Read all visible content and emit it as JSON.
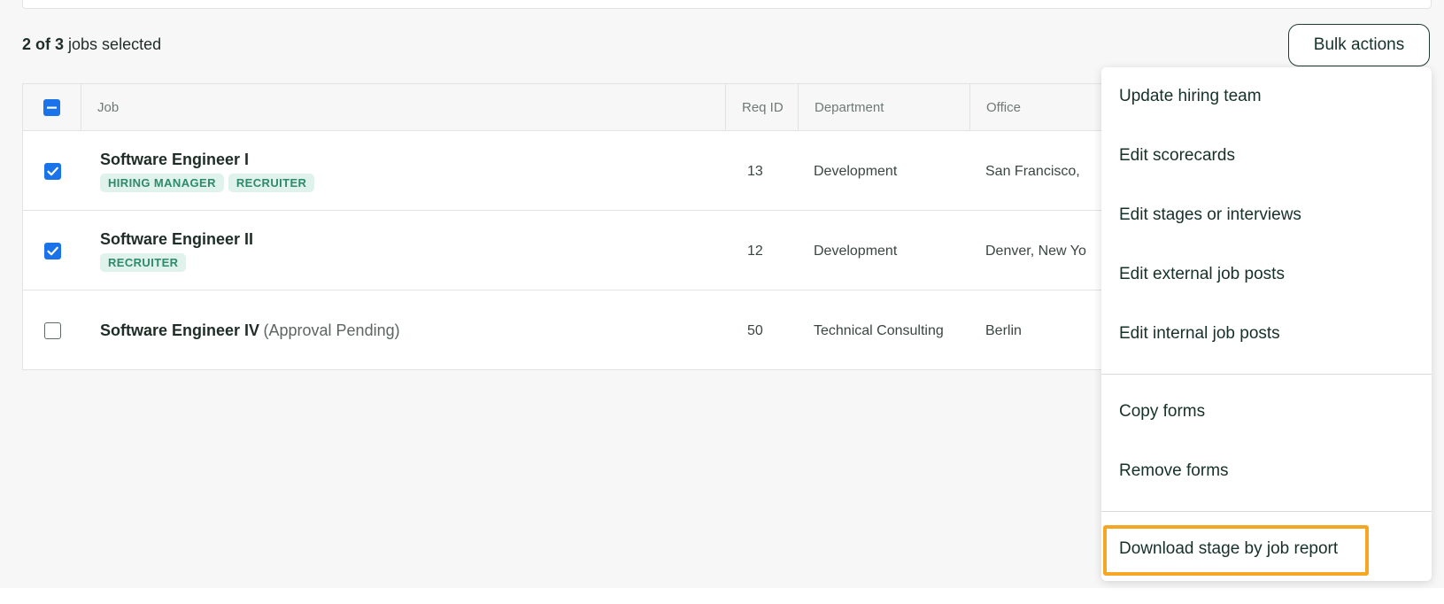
{
  "summary": {
    "selected": "2 of 3",
    "suffix": "jobs selected"
  },
  "bulk_actions": {
    "label": "Bulk actions"
  },
  "table": {
    "columns": [
      "Job",
      "Req ID",
      "Department",
      "Office"
    ],
    "rows": [
      {
        "checked": true,
        "title": "Software Engineer I",
        "note": "",
        "tags": [
          "HIRING MANAGER",
          "RECRUITER"
        ],
        "req_id": "13",
        "department": "Development",
        "office": "San Francisco,"
      },
      {
        "checked": true,
        "title": "Software Engineer II",
        "note": "",
        "tags": [
          "RECRUITER"
        ],
        "req_id": "12",
        "department": "Development",
        "office": "Denver, New Yo"
      },
      {
        "checked": false,
        "title": "Software Engineer IV",
        "note": "(Approval Pending)",
        "tags": [],
        "req_id": "50",
        "department": "Technical Consulting",
        "office": "Berlin"
      }
    ]
  },
  "menu": {
    "items": [
      "Update hiring team",
      "Edit scorecards",
      "Edit stages or interviews",
      "Edit external job posts",
      "Edit internal job posts",
      "Copy forms",
      "Remove forms",
      "Download stage by job report"
    ]
  },
  "colors": {
    "checkbox_blue": "#1a73e8",
    "tag_bg": "#dff2eb",
    "tag_text": "#2e8a6a",
    "highlight": "#f5a623"
  }
}
